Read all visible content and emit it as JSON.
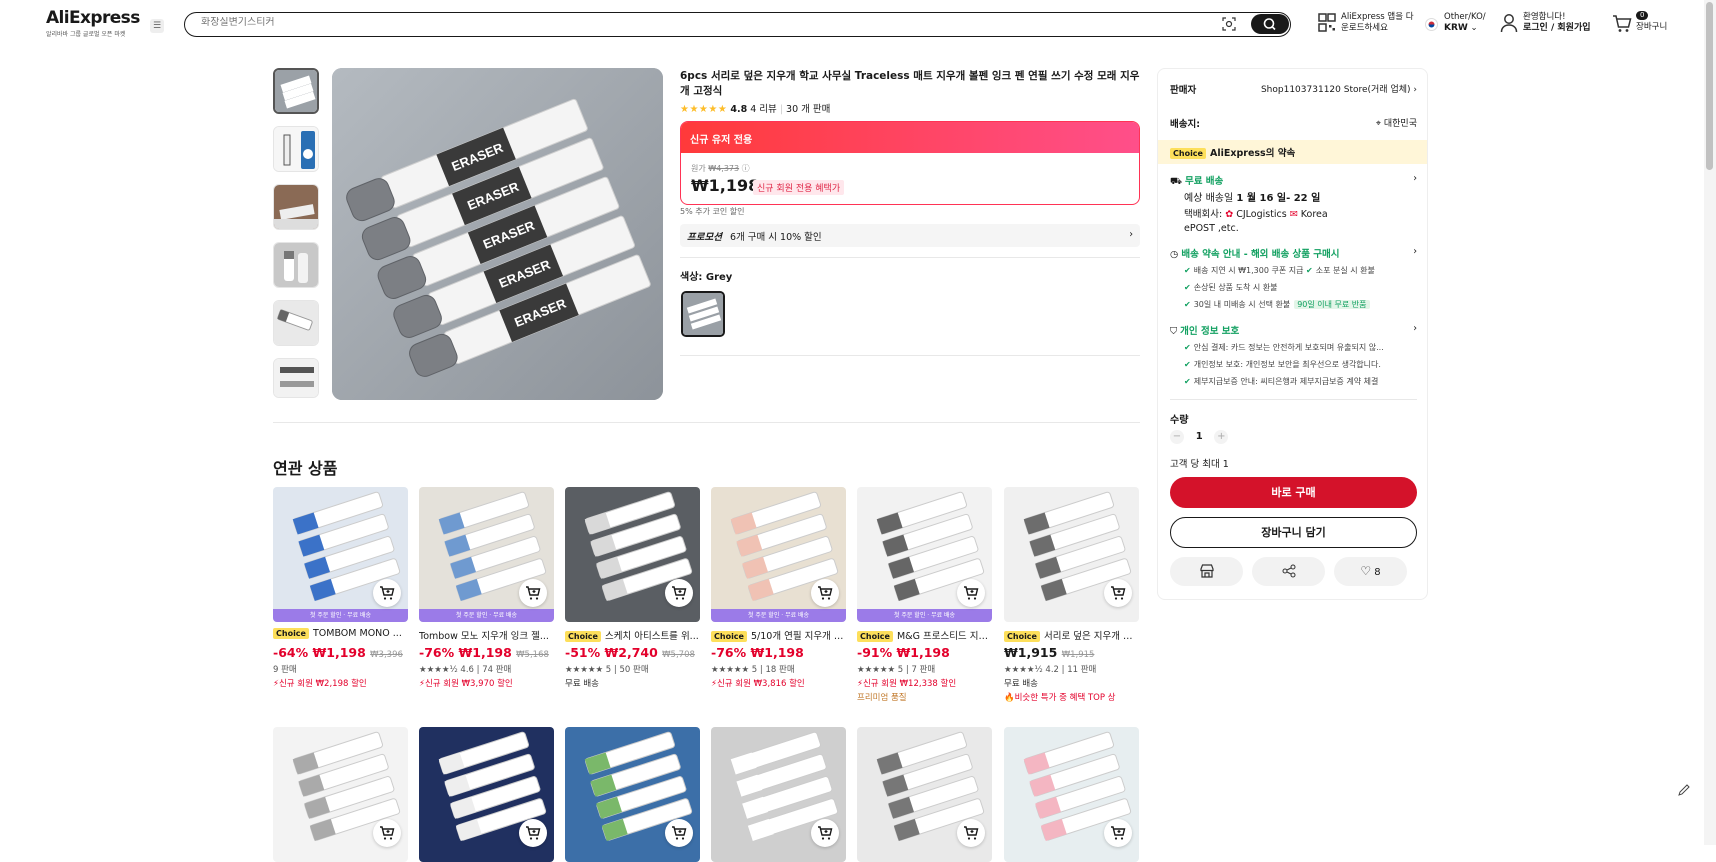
{
  "header": {
    "logo": "AliExpress",
    "logo_sub": "알리바바 그룹 글로벌 오픈 마켓",
    "search_placeholder": "화장실변기스티커",
    "app_line1": "AliExpress 앱을 다",
    "app_line2": "운로드하세요",
    "locale_line1": "Other/KO/",
    "locale_line2": "KRW",
    "welcome": "환영합니다!",
    "login": "로그인 / 회원가입",
    "cart_count": "0",
    "cart_label": "장바구니"
  },
  "product": {
    "title": "6pcs 서리로 덮은 지우개 학교 사무실 Traceless 매트 지우개 볼펜 잉크 펜 연필 쓰기 수정 모래 지우개 고정식",
    "rating": "4.8",
    "reviews": "4 리뷰",
    "sold": "30 개 판매",
    "banner": "신규 유저 전용",
    "orig_label": "원가",
    "orig_price": "₩4,373",
    "price": "₩1,198",
    "new_badge": "신규 회원 전용 혜택가",
    "coin": "5% 추가 코인 할인",
    "promo_label": "프로모션",
    "promo_text": "6개 구매 시 10% 할인",
    "color_label": "색상: Grey"
  },
  "seller": {
    "label": "판매자",
    "name": "Shop1103731120 Store(거래 업체)",
    "ship_label": "배송지:",
    "ship_to": "대한민국",
    "choice_chip": "Choice",
    "choice_title": "AliExpress의 약속",
    "free_ship": "무료 배송",
    "eta_pre": "예상 배송일",
    "eta": "1 월 16 일- 22 일",
    "carrier_pre": "택배회사:",
    "carrier1": "CJLogistics",
    "carrier2": "Korea",
    "carrier3": "ePOST ,etc.",
    "promise_title": "배송 약속 안내 - 해외 배송 상품 구매시",
    "p1": "배송 지연 시 ₩1,300 쿠폰 지급",
    "p2": "소포 분실 시 환불",
    "p3": "손상된 상품 도착 시 환불",
    "p4": "30일 내 미배송 시 선택 환불",
    "p4_tag": "90일 이내 무료 반품",
    "privacy_title": "개인 정보 보호",
    "q1": "안심 결제: 카드 정보는 안전하게 보호되며 유출되지 않...",
    "q2": "개인정보 보호: 개인정보 보안을 최우선으로 생각합니다.",
    "q3": "제부지급보증 안내: 씨티은행과 제부지급보증 계약 체결",
    "qty_label": "수량",
    "qty": "1",
    "limit": "고객 당 최대 1",
    "buy": "바로 구매",
    "add_cart": "장바구니 담기",
    "likes": "8"
  },
  "related": {
    "title": "연관 상품",
    "band": "첫 주문 할인 · 무료 배송",
    "items": [
      {
        "choice": "Choice",
        "name": "TOMBOM MONO ...",
        "disc": "-64%",
        "price": "₩1,198",
        "orig": "₩3,396",
        "meta": "9 판매",
        "deal": "신규 회원 ₩2,198 할인",
        "extra": ""
      },
      {
        "choice": "",
        "name": "Tombow 모노 지우개 잉크 젤...",
        "disc": "-76%",
        "price": "₩1,198",
        "orig": "₩5,168",
        "meta": "★★★★½ 4.6 | 74 판매",
        "deal": "신규 회원 ₩3,970 할인",
        "extra": ""
      },
      {
        "choice": "Choice",
        "name": "스케치 아티스트를 위...",
        "disc": "-51%",
        "price": "₩2,740",
        "orig": "₩5,708",
        "meta": "★★★★★ 5 | 50 판매",
        "deal": "무료 배송",
        "extra": ""
      },
      {
        "choice": "Choice",
        "name": "5/10개 연필 지우개 - ...",
        "disc": "-76%",
        "price": "₩1,198",
        "orig": "",
        "meta": "★★★★★ 5 | 18 판매",
        "deal": "신규 회원 ₩3,816 할인",
        "extra": ""
      },
      {
        "choice": "Choice",
        "name": "M&G 프로스티드 지우...",
        "disc": "-91%",
        "price": "₩1,198",
        "orig": "",
        "meta": "★★★★★ 5 | 7 판매",
        "deal": "신규 회원 ₩12,338 할인",
        "extra": "프리미엄 품질"
      },
      {
        "choice": "Choice",
        "name": "서리로 덮은 지우개 흔...",
        "disc": "",
        "price": "₩1,915",
        "orig": "₩1,915",
        "meta": "★★★★½ 4.2 | 11 판매",
        "deal": "무료 배송",
        "extra": "비슷한 특가 중 혜택 TOP 상"
      }
    ]
  }
}
